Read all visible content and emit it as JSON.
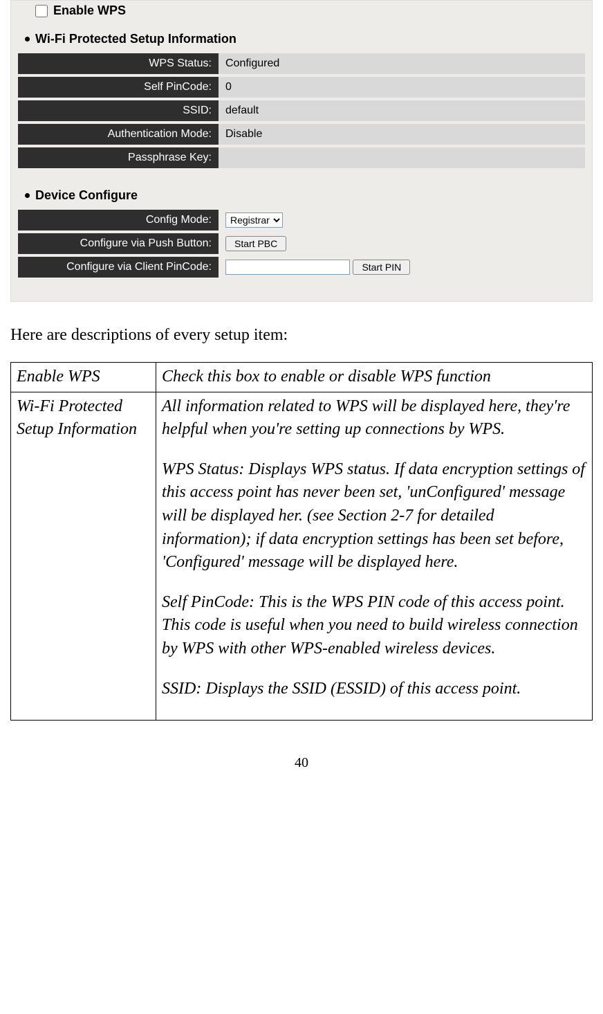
{
  "enable_wps_label": "Enable WPS",
  "section1_title": "Wi-Fi Protected Setup Information",
  "info_rows": [
    {
      "label": "WPS Status:",
      "value": "Configured"
    },
    {
      "label": "Self PinCode:",
      "value": "0"
    },
    {
      "label": "SSID:",
      "value": "default"
    },
    {
      "label": "Authentication Mode:",
      "value": "Disable"
    },
    {
      "label": "Passphrase Key:",
      "value": ""
    }
  ],
  "section2_title": "Device Configure",
  "config_mode_label": "Config Mode:",
  "config_mode_value": "Registrar",
  "push_button_label": "Configure via Push Button:",
  "start_pbc_button": "Start PBC",
  "pincode_label": "Configure via Client PinCode:",
  "pincode_value": "",
  "start_pin_button": "Start PIN",
  "intro_text": "Here are descriptions of every setup item:",
  "desc": {
    "row1": {
      "left": "Enable WPS",
      "right": "Check this box to enable or disable WPS function"
    },
    "row2": {
      "left": "Wi-Fi Protected Setup Information",
      "p1": "All information related to WPS will be displayed here, they're helpful when you're setting up connections by WPS.",
      "p2": "WPS Status: Displays WPS status. If data encryption settings of this access point has never been set, 'unConfigured' message will be displayed her. (see Section 2-7 for detailed information); if data encryption settings has been set before, 'Configured' message will be displayed here.",
      "p3": "Self PinCode: This is the WPS PIN code of this access point. This code is useful when you need to build wireless connection by WPS with other WPS-enabled wireless devices.",
      "p4": "SSID: Displays the SSID (ESSID) of this access point."
    }
  },
  "page_number": "40"
}
